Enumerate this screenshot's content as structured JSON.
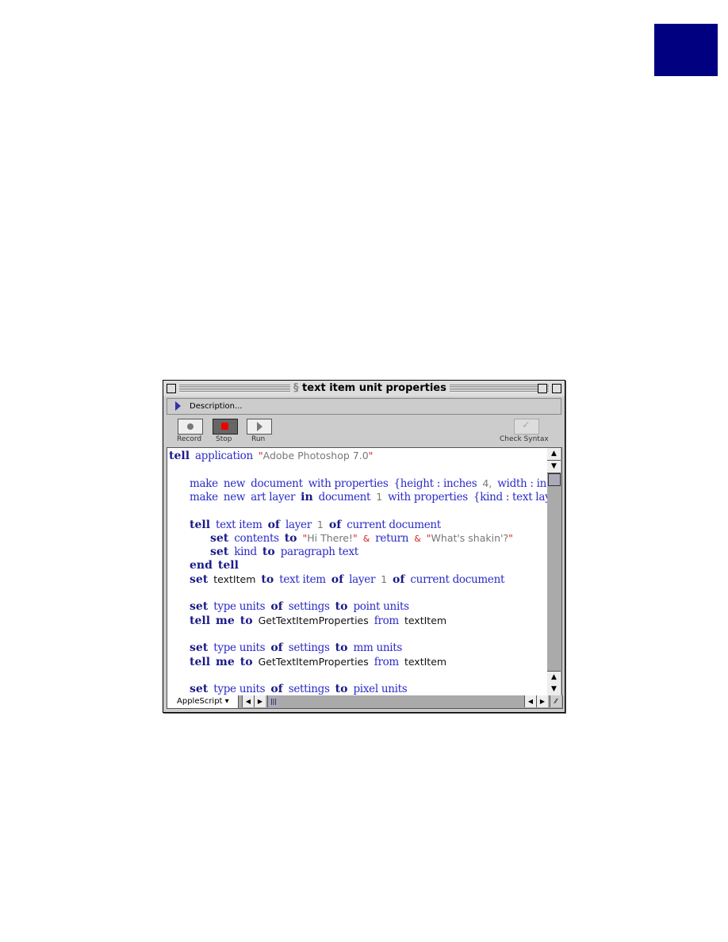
{
  "window": {
    "title": "text item unit properties",
    "description_label": "Description...",
    "language": "AppleScript"
  },
  "toolbar": {
    "record": "Record",
    "stop": "Stop",
    "run": "Run",
    "check_syntax": "Check Syntax"
  },
  "colors": {
    "tab": "#000080",
    "keyword": "#1a1a8a",
    "app_term": "#2a2ac8",
    "string": "#777777",
    "operator": "#dd2222"
  },
  "code": [
    {
      "indent": 0,
      "tokens": [
        [
          "kw",
          "tell"
        ],
        [
          "app",
          "application"
        ],
        [
          "str",
          "\"Adobe Photoshop 7.0\""
        ]
      ]
    },
    {
      "indent": 0,
      "tokens": []
    },
    {
      "indent": 1,
      "tokens": [
        [
          "app",
          "make"
        ],
        [
          "app",
          "new"
        ],
        [
          "app",
          "document"
        ],
        [
          "app",
          "with properties"
        ],
        [
          "app",
          "{height : inches"
        ],
        [
          "num",
          "4,"
        ],
        [
          "app",
          "width : inches"
        ]
      ]
    },
    {
      "indent": 1,
      "tokens": [
        [
          "app",
          "make"
        ],
        [
          "app",
          "new"
        ],
        [
          "app",
          "art layer"
        ],
        [
          "kw",
          "in"
        ],
        [
          "app",
          "document"
        ],
        [
          "num",
          "1"
        ],
        [
          "app",
          "with properties"
        ],
        [
          "app",
          "{kind : text layer"
        ]
      ]
    },
    {
      "indent": 0,
      "tokens": []
    },
    {
      "indent": 1,
      "tokens": [
        [
          "kw",
          "tell"
        ],
        [
          "app",
          "text item"
        ],
        [
          "kw",
          "of"
        ],
        [
          "app",
          "layer"
        ],
        [
          "num",
          "1"
        ],
        [
          "kw",
          "of"
        ],
        [
          "app",
          "current document"
        ]
      ]
    },
    {
      "indent": 2,
      "tokens": [
        [
          "kw",
          "set"
        ],
        [
          "app",
          "contents"
        ],
        [
          "kw",
          "to"
        ],
        [
          "str",
          "\"Hi There!\""
        ],
        [
          "op",
          "&"
        ],
        [
          "app",
          "return"
        ],
        [
          "op",
          "&"
        ],
        [
          "str",
          "\"What's shakin'?\""
        ]
      ]
    },
    {
      "indent": 2,
      "tokens": [
        [
          "kw",
          "set"
        ],
        [
          "app",
          "kind"
        ],
        [
          "kw",
          "to"
        ],
        [
          "app",
          "paragraph text"
        ]
      ]
    },
    {
      "indent": 1,
      "tokens": [
        [
          "kw",
          "end"
        ],
        [
          "kw",
          "tell"
        ]
      ]
    },
    {
      "indent": 1,
      "tokens": [
        [
          "kw",
          "set"
        ],
        [
          "var",
          "textItem"
        ],
        [
          "kw",
          "to"
        ],
        [
          "app",
          "text item"
        ],
        [
          "kw",
          "of"
        ],
        [
          "app",
          "layer"
        ],
        [
          "num",
          "1"
        ],
        [
          "kw",
          "of"
        ],
        [
          "app",
          "current document"
        ]
      ]
    },
    {
      "indent": 0,
      "tokens": []
    },
    {
      "indent": 1,
      "tokens": [
        [
          "kw",
          "set"
        ],
        [
          "app",
          "type units"
        ],
        [
          "kw",
          "of"
        ],
        [
          "app",
          "settings"
        ],
        [
          "kw",
          "to"
        ],
        [
          "app",
          "point units"
        ]
      ]
    },
    {
      "indent": 1,
      "tokens": [
        [
          "kw",
          "tell"
        ],
        [
          "kw",
          "me"
        ],
        [
          "kw",
          "to"
        ],
        [
          "var",
          "GetTextItemProperties"
        ],
        [
          "app",
          "from"
        ],
        [
          "var",
          "textItem"
        ]
      ]
    },
    {
      "indent": 0,
      "tokens": []
    },
    {
      "indent": 1,
      "tokens": [
        [
          "kw",
          "set"
        ],
        [
          "app",
          "type units"
        ],
        [
          "kw",
          "of"
        ],
        [
          "app",
          "settings"
        ],
        [
          "kw",
          "to"
        ],
        [
          "app",
          "mm units"
        ]
      ]
    },
    {
      "indent": 1,
      "tokens": [
        [
          "kw",
          "tell"
        ],
        [
          "kw",
          "me"
        ],
        [
          "kw",
          "to"
        ],
        [
          "var",
          "GetTextItemProperties"
        ],
        [
          "app",
          "from"
        ],
        [
          "var",
          "textItem"
        ]
      ]
    },
    {
      "indent": 0,
      "tokens": []
    },
    {
      "indent": 1,
      "tokens": [
        [
          "kw",
          "set"
        ],
        [
          "app",
          "type units"
        ],
        [
          "kw",
          "of"
        ],
        [
          "app",
          "settings"
        ],
        [
          "kw",
          "to"
        ],
        [
          "app",
          "pixel units"
        ]
      ]
    }
  ]
}
